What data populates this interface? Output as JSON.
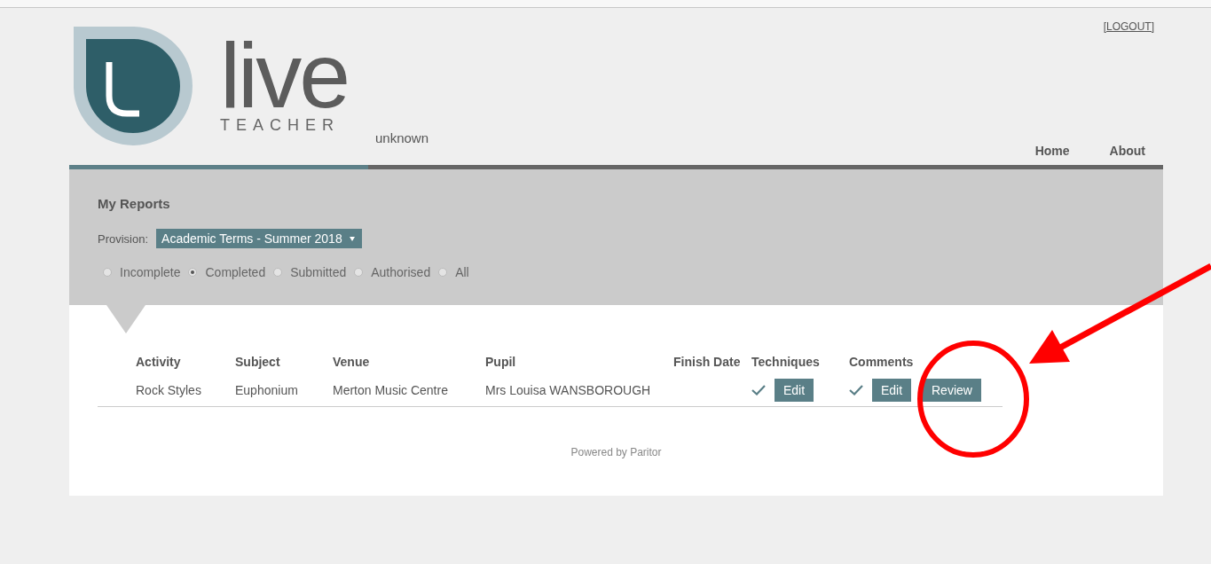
{
  "header": {
    "logo": {
      "word": "live",
      "subtitle": "TEACHER"
    },
    "user": "unknown",
    "logout": "[LOGOUT]",
    "nav": [
      {
        "label": "Home"
      },
      {
        "label": "About"
      }
    ]
  },
  "reports": {
    "title": "My Reports",
    "provision_label": "Provision:",
    "provision": "Academic Terms - Summer 2018",
    "filters": [
      {
        "label": "Incomplete",
        "selected": false
      },
      {
        "label": "Completed",
        "selected": true
      },
      {
        "label": "Submitted",
        "selected": false
      },
      {
        "label": "Authorised",
        "selected": false
      },
      {
        "label": "All",
        "selected": false
      }
    ]
  },
  "table": {
    "columns": [
      "Activity",
      "Subject",
      "Venue",
      "Pupil",
      "Finish Date",
      "Techniques",
      "Comments"
    ],
    "rows": [
      {
        "activity": "Rock Styles",
        "subject": "Euphonium",
        "venue": "Merton Music Centre",
        "pupil": "Mrs Louisa WANSBOROUGH",
        "techniques": {
          "done": true,
          "button": "Edit"
        },
        "comments": {
          "done": true,
          "button": "Edit"
        },
        "review": "Review"
      }
    ]
  },
  "footer": "Powered by Paritor"
}
